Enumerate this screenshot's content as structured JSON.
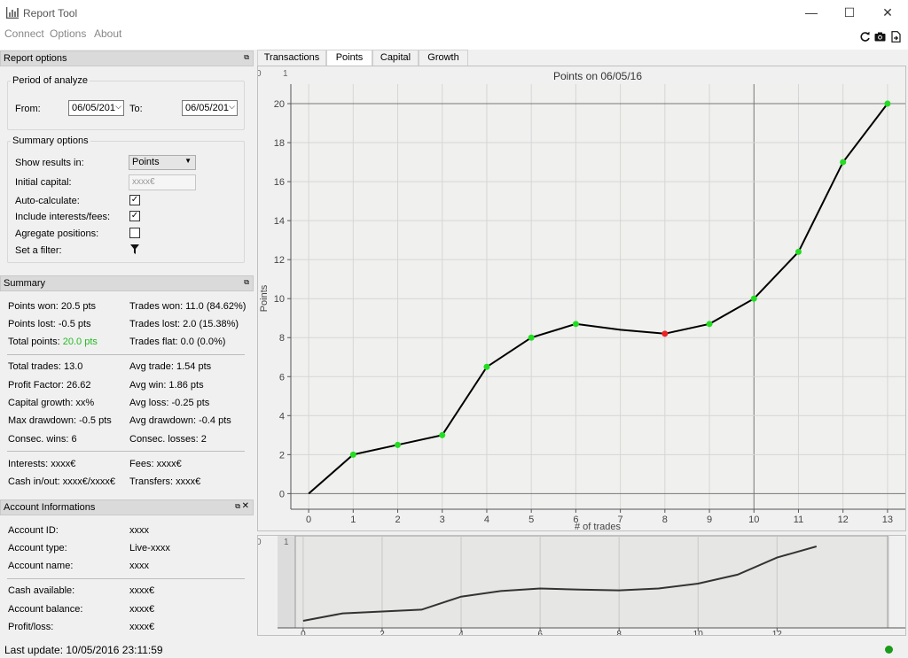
{
  "window": {
    "title": "Report Tool",
    "minimize": "—",
    "maximize": "☐",
    "close": "✕"
  },
  "menu": [
    "Connect",
    "Options",
    "About"
  ],
  "report_options": {
    "header": "Report options",
    "period_title": "Period of analyze",
    "from_label": "From:",
    "from_value": "06/05/201",
    "to_label": "To:",
    "to_value": "06/05/201",
    "summary_title": "Summary options",
    "show_results_label": "Show results in:",
    "show_results_value": "Points",
    "initial_capital_label": "Initial capital:",
    "initial_capital_placeholder": "xxxx€",
    "auto_calc_label": "Auto-calculate:",
    "auto_calc": true,
    "interests_label": "Include interests/fees:",
    "interests": true,
    "aggregate_label": "Agregate positions:",
    "aggregate": false,
    "filter_label": "Set a filter:"
  },
  "summary": {
    "header": "Summary",
    "points_won": "Points won: 20.5 pts",
    "trades_won": "Trades won: 11.0 (84.62%)",
    "points_lost": "Points lost: -0.5 pts",
    "trades_lost": "Trades lost: 2.0 (15.38%)",
    "total_points_label": "Total points: ",
    "total_points_value": "20.0 pts",
    "total_points_color": "#22bb22",
    "trades_flat": "Trades flat: 0.0 (0.0%)",
    "total_trades": "Total trades: 13.0",
    "avg_trade": "Avg trade: 1.54 pts",
    "profit_factor": "Profit Factor: 26.62",
    "avg_win": "Avg win: 1.86 pts",
    "capital_growth": "Capital growth: xx%",
    "avg_loss": "Avg loss: -0.25 pts",
    "max_drawdown": "Max drawdown: -0.5 pts",
    "avg_drawdown": "Avg drawdown: -0.4 pts",
    "consec_wins": "Consec. wins: 6",
    "consec_losses": "Consec. losses: 2",
    "interests": "Interests: xxxx€",
    "fees": "Fees: xxxx€",
    "cash_inout": "Cash in/out: xxxx€/xxxx€",
    "transfers": "Transfers: xxxx€"
  },
  "account": {
    "header": "Account Informations",
    "id_label": "Account ID:",
    "id_value": "xxxx",
    "type_label": "Account type:",
    "type_value": "Live-xxxx",
    "name_label": "Account name:",
    "name_value": "xxxx",
    "cash_label": "Cash available:",
    "cash_value": "xxxx€",
    "balance_label": "Account balance:",
    "balance_value": "xxxx€",
    "pl_label": "Profit/loss:",
    "pl_value": "xxxx€"
  },
  "tabs": [
    "Transactions",
    "Points",
    "Capital",
    "Growth"
  ],
  "active_tab": "Points",
  "status": {
    "last_update": "Last update: 10/05/2016 23:11:59",
    "connection_color": "#1a9b1a"
  },
  "chart_data": {
    "type": "line",
    "title": "Points on 06/05/16",
    "xlabel": "# of trades",
    "ylabel": "Points",
    "x": [
      0,
      1,
      2,
      3,
      4,
      5,
      6,
      7,
      8,
      9,
      10,
      11,
      12,
      13
    ],
    "y": [
      0,
      2,
      2.5,
      3,
      6.5,
      8,
      8.7,
      8.4,
      8.2,
      8.7,
      10,
      12.4,
      17,
      20
    ],
    "markers": [
      "none",
      "green",
      "green",
      "green",
      "green",
      "green",
      "green",
      "none",
      "red",
      "green",
      "green",
      "green",
      "green",
      "green"
    ],
    "marker_colors": {
      "green": "#22dd22",
      "red": "#ee2222"
    },
    "xlim": [
      -0.4,
      13.4
    ],
    "ylim": [
      -0.8,
      21
    ],
    "yticks": [
      0,
      2,
      4,
      6,
      8,
      10,
      12,
      14,
      16,
      18,
      20
    ],
    "xticks": [
      0,
      1,
      2,
      3,
      4,
      5,
      6,
      7,
      8,
      9,
      10,
      11,
      12,
      13
    ],
    "grid": true,
    "corner_labels": [
      "0",
      "1"
    ],
    "navigator": {
      "xticks": [
        0,
        2,
        4,
        6,
        8,
        10,
        12
      ],
      "corner_labels": [
        "0",
        "1"
      ]
    }
  }
}
